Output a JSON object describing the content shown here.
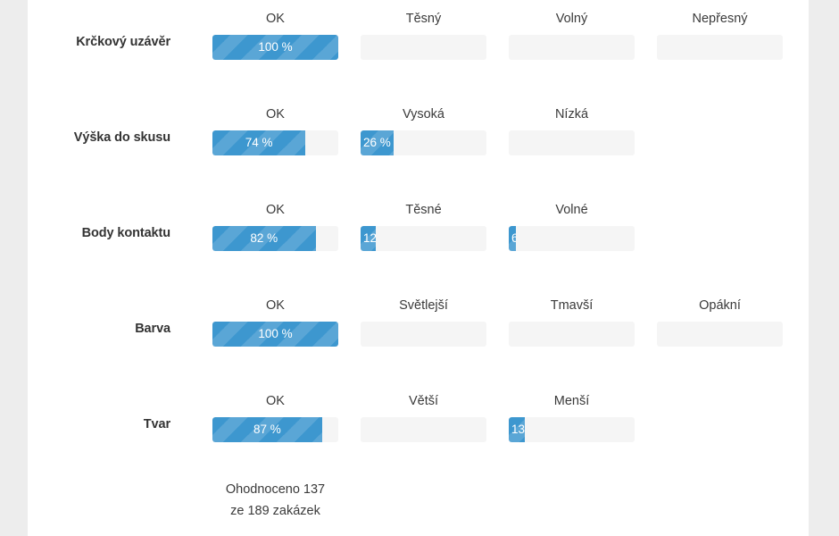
{
  "chart_data": {
    "type": "bar",
    "title": "",
    "orientation": "horizontal",
    "xlabel": "",
    "ylabel": "",
    "xlim": [
      0,
      100
    ],
    "grid": false,
    "legend": "none",
    "unit": "%",
    "bar_track_color": "#f5f5f5",
    "bar_fill_color": "#3d97cf",
    "categories": [
      "Krčkový uzávěr",
      "Výška do skusu",
      "Body kontaktu",
      "Barva",
      "Tvar"
    ],
    "rows": [
      {
        "label": "Krčkový uzávěr",
        "cells": [
          {
            "header": "OK",
            "value": 100,
            "display": "100 %"
          },
          {
            "header": "Těsný",
            "value": 0,
            "display": "0"
          },
          {
            "header": "Volný",
            "value": 0,
            "display": "0"
          },
          {
            "header": "Nepřesný",
            "value": 0,
            "display": "0"
          }
        ]
      },
      {
        "label": "Výška do skusu",
        "cells": [
          {
            "header": "OK",
            "value": 74,
            "display": "74 %"
          },
          {
            "header": "Vysoká",
            "value": 26,
            "display": "26 %"
          },
          {
            "header": "Nízká",
            "value": 0,
            "display": "0"
          }
        ]
      },
      {
        "label": "Body kontaktu",
        "cells": [
          {
            "header": "OK",
            "value": 82,
            "display": "82 %"
          },
          {
            "header": "Těsné",
            "value": 12,
            "display": "12"
          },
          {
            "header": "Volné",
            "value": 6,
            "display": "6"
          }
        ]
      },
      {
        "label": "Barva",
        "cells": [
          {
            "header": "OK",
            "value": 100,
            "display": "100 %"
          },
          {
            "header": "Světlejší",
            "value": 0,
            "display": "0"
          },
          {
            "header": "Tmavší",
            "value": 0,
            "display": "0"
          },
          {
            "header": "Opákní",
            "value": 0,
            "display": "0"
          }
        ]
      },
      {
        "label": "Tvar",
        "cells": [
          {
            "header": "OK",
            "value": 87,
            "display": "87 %"
          },
          {
            "header": "Větší",
            "value": 0,
            "display": "0"
          },
          {
            "header": "Menší",
            "value": 13,
            "display": "13"
          }
        ]
      }
    ]
  },
  "footer": {
    "line1": "Ohodnoceno 137",
    "line2": "ze 189 zakázek"
  }
}
